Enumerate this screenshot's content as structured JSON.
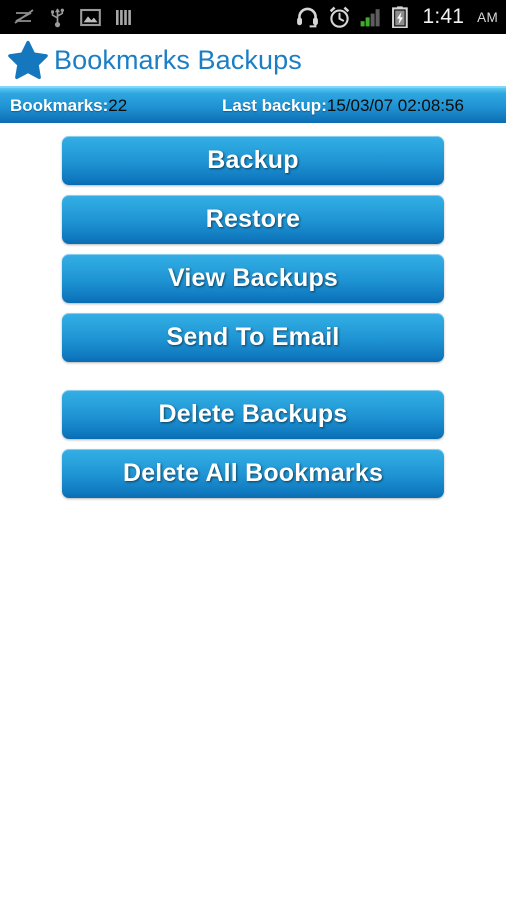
{
  "status_bar": {
    "left_icons": [
      {
        "name": "sync-disabled-icon"
      },
      {
        "name": "usb-icon"
      },
      {
        "name": "screenshot-image-icon"
      },
      {
        "name": "sim-toolkit-icon"
      }
    ],
    "right_icons": [
      {
        "name": "headset-icon"
      },
      {
        "name": "alarm-clock-icon"
      },
      {
        "name": "signal-bars-icon",
        "bars_filled": 2,
        "bars_total": 4
      },
      {
        "name": "battery-charging-icon"
      }
    ],
    "time": "1:41",
    "meridiem": "AM",
    "background_color": "#000000",
    "signal_color": "#3fae29"
  },
  "title_bar": {
    "icon": "star-icon",
    "title": "Bookmarks Backups",
    "title_color": "#1c7ec4",
    "background_color": "#ffffff"
  },
  "info_bar": {
    "bookmarks_label": "Bookmarks:",
    "bookmarks_value": "22",
    "last_backup_label": "Last backup:",
    "last_backup_value": "15/03/07 02:08:56",
    "label_color": "#ffffff",
    "value_color": "#0c0c0c",
    "gradient_top": "#5cc8f2",
    "gradient_bottom": "#0d6db3"
  },
  "main": {
    "primary_buttons": [
      {
        "name": "backup-button",
        "label": "Backup"
      },
      {
        "name": "restore-button",
        "label": "Restore"
      },
      {
        "name": "view-backups-button",
        "label": "View Backups"
      },
      {
        "name": "send-to-email-button",
        "label": "Send To Email"
      }
    ],
    "secondary_buttons": [
      {
        "name": "delete-backups-button",
        "label": "Delete Backups"
      },
      {
        "name": "delete-all-bookmarks-button",
        "label": "Delete All Bookmarks"
      }
    ],
    "button_gradient_top": "#34aee4",
    "button_gradient_bottom": "#0a6cb2",
    "button_text_color": "#ffffff",
    "background_color": "#ffffff"
  }
}
